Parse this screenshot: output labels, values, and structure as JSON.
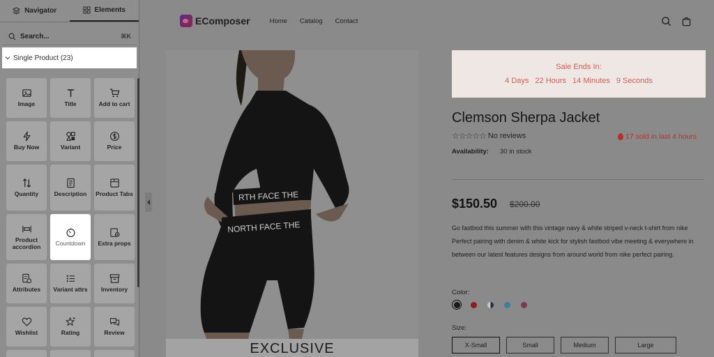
{
  "panel": {
    "tabs": [
      {
        "label": "Navigator",
        "icon": "layers-icon"
      },
      {
        "label": "Elements",
        "icon": "grid-icon"
      }
    ],
    "search_placeholder": "Search...",
    "search_shortcut": "⌘K",
    "group_label": "Single Product (23)",
    "elements": [
      {
        "label": "Image",
        "icon": "image-icon"
      },
      {
        "label": "Title",
        "icon": "title-icon"
      },
      {
        "label": "Add to cart",
        "icon": "cart-icon"
      },
      {
        "label": "Buy Now",
        "icon": "lightning-icon"
      },
      {
        "label": "Variant",
        "icon": "variant-icon"
      },
      {
        "label": "Price",
        "icon": "dollar-icon"
      },
      {
        "label": "Quantity",
        "icon": "sort-icon"
      },
      {
        "label": "Description",
        "icon": "document-icon"
      },
      {
        "label": "Product Tabs",
        "icon": "tabs-icon"
      },
      {
        "label": "Product accordion",
        "icon": "accordion-icon"
      },
      {
        "label": "Countdown",
        "icon": "timer-icon"
      },
      {
        "label": "Extra props",
        "icon": "extra-props-icon"
      },
      {
        "label": "Attributes",
        "icon": "attributes-icon"
      },
      {
        "label": "Variant attrs",
        "icon": "list-icon"
      },
      {
        "label": "Inventory",
        "icon": "archive-icon"
      },
      {
        "label": "Wishlist",
        "icon": "heart-icon"
      },
      {
        "label": "Rating",
        "icon": "sparkle-star-icon"
      },
      {
        "label": "Review",
        "icon": "chat-icon"
      }
    ],
    "highlighted_element": "Countdown"
  },
  "store": {
    "logo_text": "EComposer",
    "nav": [
      "Home",
      "Catalog",
      "Contact"
    ],
    "icons": [
      "search-icon",
      "bag-icon"
    ]
  },
  "product": {
    "image_banner": "EXCLUSIVE",
    "sale_title": "Sale Ends In:",
    "countdown": [
      "4 Days",
      "22 Hours",
      "14 Minutes",
      "9 Seconds"
    ],
    "title": "Clemson Sherpa Jacket",
    "stars": "☆☆☆☆☆",
    "reviews": "No reviews",
    "sold": "17 sold in last 4 hours",
    "availability_label": "Availability:",
    "availability_value": "30 in stock",
    "price": "$150.50",
    "compare_price": "$200.00",
    "description": "Go fastbod this summer with this vintage navy & white striped v-neck t-shirt from nike Perfect pairing with denim & white kick for stylish fastbod vibe meeting & everywhere in between our latest features designs from around world from nike perfect pairing.",
    "color_label": "Color:",
    "colors": [
      "#1a1a1a",
      "#8b1e1e",
      "#1f2f4a",
      "#3d7f9a",
      "#7a3a55"
    ],
    "size_label": "Size:",
    "sizes": [
      "X-Small",
      "Small",
      "Medium",
      "Large"
    ]
  },
  "colors": {
    "sale_text": "#c85f55",
    "sale_bg": "#efe7e4",
    "sold_text": "#b5322c",
    "overlay": "#8c8c8c"
  }
}
